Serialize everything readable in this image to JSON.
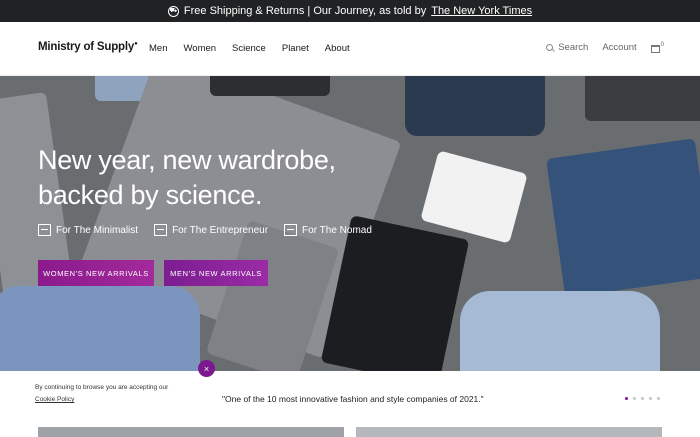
{
  "announcement": {
    "icon": "truck-circle-icon",
    "text": "Free Shipping & Returns | Our Journey, as told by",
    "link": "The New York Times"
  },
  "header": {
    "logo": "Ministry of Supply",
    "nav": [
      "Men",
      "Women",
      "Science",
      "Planet",
      "About"
    ],
    "search_label": "Search",
    "account_label": "Account",
    "bag_count": "0"
  },
  "hero": {
    "headline_line1": "New year, new wardrobe,",
    "headline_line2": "backed by science.",
    "personas": [
      {
        "label": "For The Minimalist",
        "icon": "minimalist-icon"
      },
      {
        "label": "For The Entrepreneur",
        "icon": "entrepreneur-icon"
      },
      {
        "label": "For The Nomad",
        "icon": "nomad-icon"
      }
    ],
    "cta_women": "WOMEN'S NEW ARRIVALS",
    "cta_men": "MEN'S NEW ARRIVALS"
  },
  "cookie": {
    "text": "By continuing to browse you are accepting our",
    "policy": "Cookie Policy",
    "close": "×"
  },
  "quote": {
    "text": "\"One of the 10 most innovative fashion and style companies of 2021.\""
  },
  "colors": {
    "announce_bg": "#202224",
    "accent": "#7b1a8e",
    "hero_bg": "#6a6d70"
  }
}
